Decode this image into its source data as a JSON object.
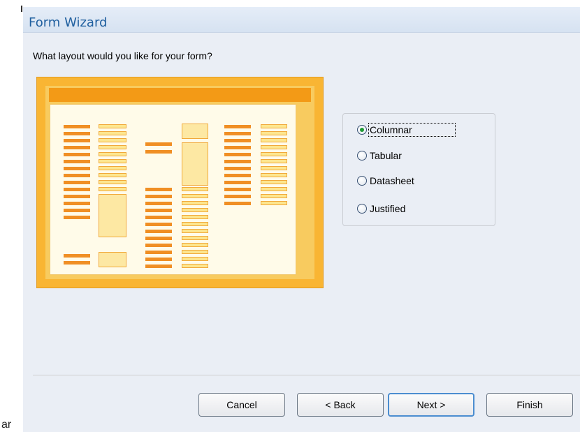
{
  "stray_text": "ar",
  "window": {
    "title": "Form Wizard"
  },
  "question": "What layout would you like for your form?",
  "layout_options": [
    {
      "label": "Columnar",
      "selected": true
    },
    {
      "label": "Tabular",
      "selected": false
    },
    {
      "label": "Datasheet",
      "selected": false
    },
    {
      "label": "Justified",
      "selected": false
    }
  ],
  "buttons": {
    "cancel": "Cancel",
    "back": "< Back",
    "next": "Next >",
    "finish": "Finish"
  },
  "colors": {
    "title": "#1f5f9f",
    "preview_frame": "#f9b533",
    "preview_header": "#f39a16",
    "radio_selected": "#1f9a34"
  }
}
